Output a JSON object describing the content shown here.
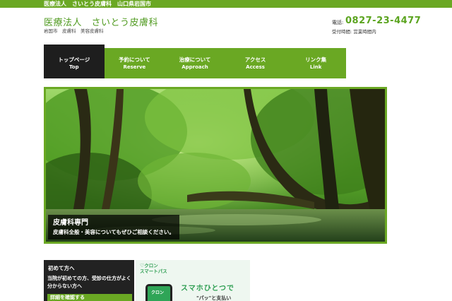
{
  "topbar": {
    "text": "医療法人　さいとう皮膚科　山口県岩国市"
  },
  "header": {
    "clinic_name": "医療法人　さいとう皮膚科",
    "subtitle": "岩国市　皮膚科　美容皮膚科",
    "phone_label": "電話:",
    "phone_number": "0827-23-4477",
    "hours": "受付時間: 営業時間内"
  },
  "nav": {
    "items": [
      {
        "jp": "トップページ",
        "en": "Top",
        "active": true
      },
      {
        "jp": "予約について",
        "en": "Reserve",
        "active": false
      },
      {
        "jp": "治療について",
        "en": "Approach",
        "active": false
      },
      {
        "jp": "アクセス",
        "en": "Access",
        "active": false
      },
      {
        "jp": "リンク集",
        "en": "Link",
        "active": false
      }
    ]
  },
  "hero": {
    "title": "皮膚科専門",
    "description": "皮膚科全般・美容についてもぜひご相談ください。",
    "image_subject": "forest stream"
  },
  "first_visit": {
    "title": "初めて方へ",
    "description": "当院が初めての方、受診の仕方がよく分からない方へ",
    "button": "詳細を確認する"
  },
  "banner": {
    "logo_line1": "クロン",
    "logo_line2": "スマートパス",
    "phone_app_text": "クロン",
    "headline": "スマホひとつで",
    "subline": "\"パッ\"と支払い"
  },
  "colors": {
    "accent": "#6aa823",
    "nav_active": "#1e1e1e",
    "phone_text": "#5ba41f",
    "banner_green": "#2e9e52"
  }
}
